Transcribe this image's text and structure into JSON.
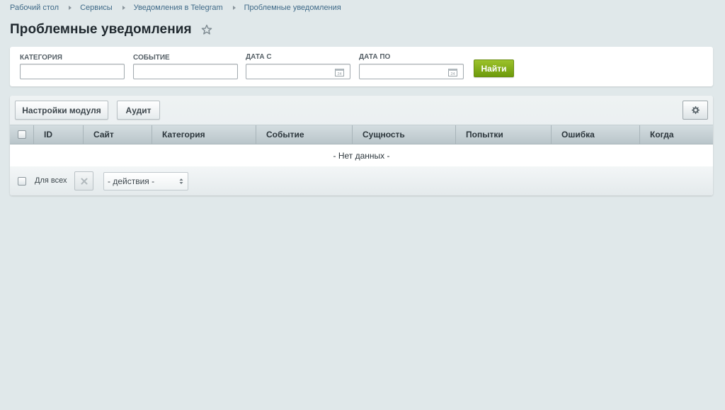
{
  "breadcrumb": [
    "Рабочий стол",
    "Сервисы",
    "Уведомления в Telegram",
    "Проблемные уведомления"
  ],
  "page": {
    "title": "Проблемные уведомления"
  },
  "filter": {
    "category": {
      "label": "КАТЕГОРИЯ",
      "value": ""
    },
    "event": {
      "label": "СОБЫТИЕ",
      "value": ""
    },
    "date_from": {
      "label": "ДАТА С",
      "value": ""
    },
    "date_to": {
      "label": "ДАТА ПО",
      "value": ""
    },
    "find_label": "Найти",
    "calendar_icon": "calendar-icon",
    "calendar_day": "24"
  },
  "toolbar": {
    "settings_label": "Настройки модуля",
    "audit_label": "Аудит",
    "gear_icon": "gear-icon"
  },
  "grid": {
    "columns": [
      "ID",
      "Сайт",
      "Категория",
      "Событие",
      "Сущность",
      "Попытки",
      "Ошибка",
      "Когда"
    ],
    "empty_text": "- Нет данных -"
  },
  "footer": {
    "for_all_label": "Для всех",
    "delete_icon": "close-icon",
    "actions_value": "- действия -"
  },
  "colors": {
    "background": "#e0e8ea",
    "accent_green": "#7aa614",
    "link": "#3f6a88"
  }
}
